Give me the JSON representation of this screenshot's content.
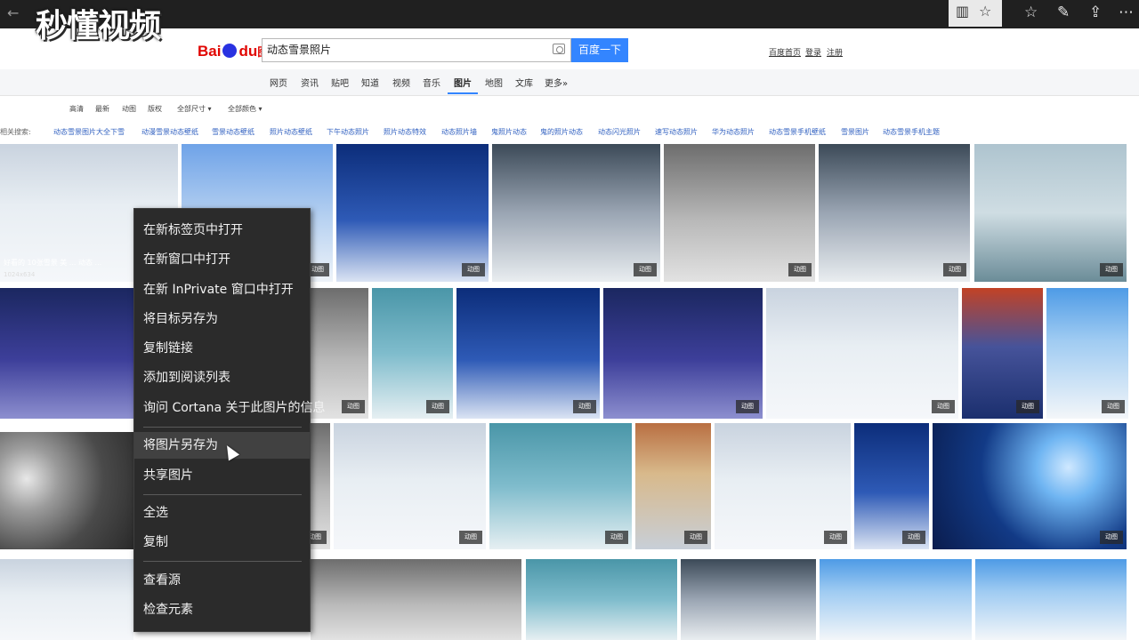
{
  "watermark": {
    "text": "秒懂视频"
  },
  "chrome": {
    "back": "←",
    "forward": "→"
  },
  "header": {
    "logo_text": "Bai",
    "logo_text2": "du",
    "logo_pics": "图片",
    "search_value": "动态雪景照片",
    "search_button": "百度一下",
    "links": [
      "百度首页",
      "登录",
      "注册"
    ]
  },
  "tabs": [
    "网页",
    "资讯",
    "贴吧",
    "知道",
    "视频",
    "音乐",
    "图片",
    "地图",
    "文库",
    "更多»"
  ],
  "active_tab": "图片",
  "filters": [
    "高清",
    "最新",
    "动图",
    "版权",
    "全部尺寸 ▾",
    "全部颜色 ▾"
  ],
  "related": {
    "label": "相关搜索:",
    "items": [
      "动态雪景图片大全下雪",
      "动漫雪景动态壁纸",
      "雪景动态壁纸",
      "照片动态壁纸",
      "下午动态照片",
      "照片动态特效",
      "动态照片墙",
      "鬼照片动态",
      "鬼的照片动态",
      "动态闪光照片",
      "速写动态照片",
      "华为动态照片",
      "动态雪景手机壁纸",
      "雪景图片",
      "动态雪景手机主题"
    ]
  },
  "grid": {
    "badge": "动图",
    "first_caption": "好看的 10张雪景 美 ... 动态 ...",
    "first_size": "1024x634"
  },
  "context_menu": {
    "items": [
      "在新标签页中打开",
      "在新窗口中打开",
      "在新 InPrivate 窗口中打开",
      "将目标另存为",
      "复制链接",
      "添加到阅读列表",
      "询问 Cortana 关于此图片的信息",
      "将图片另存为",
      "共享图片",
      "全选",
      "复制",
      "查看源",
      "检查元素"
    ],
    "hover_item": "将图片另存为"
  }
}
